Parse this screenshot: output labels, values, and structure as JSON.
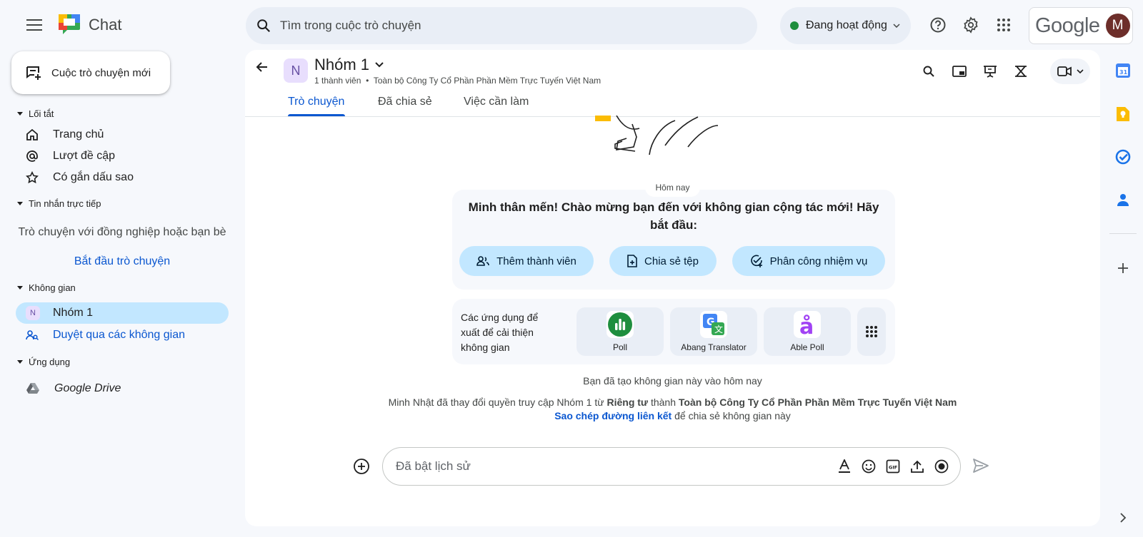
{
  "app": {
    "name": "Chat"
  },
  "search": {
    "placeholder": "Tìm trong cuộc trò chuyện"
  },
  "status": {
    "label": "Đang hoạt động"
  },
  "account": {
    "brand": "Google",
    "avatar_initial": "M"
  },
  "sidebar": {
    "new_chat": "Cuộc trò chuyện mới",
    "shortcuts": {
      "title": "Lối tắt",
      "items": [
        {
          "label": "Trang chủ",
          "icon": "home-icon"
        },
        {
          "label": "Lượt đề cập",
          "icon": "at-icon"
        },
        {
          "label": "Có gắn dấu sao",
          "icon": "star-icon"
        }
      ]
    },
    "direct": {
      "title": "Tin nhắn trực tiếp",
      "empty_text": "Trò chuyện với đồng nghiệp hoặc bạn bè",
      "start_link": "Bắt đầu trò chuyện"
    },
    "spaces": {
      "title": "Không gian",
      "items": [
        {
          "label": "Nhóm 1",
          "avatar": "N",
          "active": true
        },
        {
          "label": "Duyệt qua các không gian",
          "icon": "browse-spaces-icon"
        }
      ]
    },
    "apps": {
      "title": "Ứng dụng",
      "items": [
        {
          "label": "Google Drive",
          "icon": "google-drive-icon"
        }
      ]
    }
  },
  "space": {
    "avatar": "N",
    "title": "Nhóm 1",
    "members": "1 thành viên",
    "separator": "•",
    "org": "Toàn bộ Công Ty Cổ Phần Phần Mềm Trực Tuyến Việt Nam",
    "tabs": [
      {
        "label": "Trò chuyện",
        "active": true
      },
      {
        "label": "Đã chia sẻ",
        "active": false
      },
      {
        "label": "Việc cần làm",
        "active": false
      }
    ]
  },
  "feed": {
    "day_label": "Hôm nay",
    "welcome": "Minh thân mến! Chào mừng bạn đến với không gian cộng tác mới! Hãy bắt đầu:",
    "actions": [
      {
        "label": "Thêm thành viên",
        "icon": "add-people-icon"
      },
      {
        "label": "Chia sẻ tệp",
        "icon": "share-file-icon"
      },
      {
        "label": "Phân công nhiệm vụ",
        "icon": "assign-task-icon"
      }
    ],
    "apps_label": "Các ứng dụng để xuất để cải thiện không gian",
    "apps": [
      {
        "name": "Poll",
        "color": "#1e8e3e"
      },
      {
        "name": "Abang Translator",
        "color": "#4285f4"
      },
      {
        "name": "Able Poll",
        "color": "#a142f4"
      }
    ],
    "created": "Bạn đã tạo không gian này vào hôm nay",
    "access_change": {
      "pre": "Minh Nhật đã thay đổi quyền truy cập Nhóm 1 từ ",
      "from": "Riêng tư",
      "mid": " thành ",
      "to": "Toàn bộ Công Ty Cổ Phần Phần Mềm Trực Tuyến Việt Nam"
    },
    "copy_link": "Sao chép đường liên kết",
    "copy_suffix": " để chia sẻ không gian này"
  },
  "composer": {
    "placeholder": "Đã bật lịch sử"
  },
  "colors": {
    "accent": "#0b57d0",
    "chip": "#c2e7ff",
    "active_nav": "#c2e7ff",
    "online": "#1e8e3e"
  }
}
